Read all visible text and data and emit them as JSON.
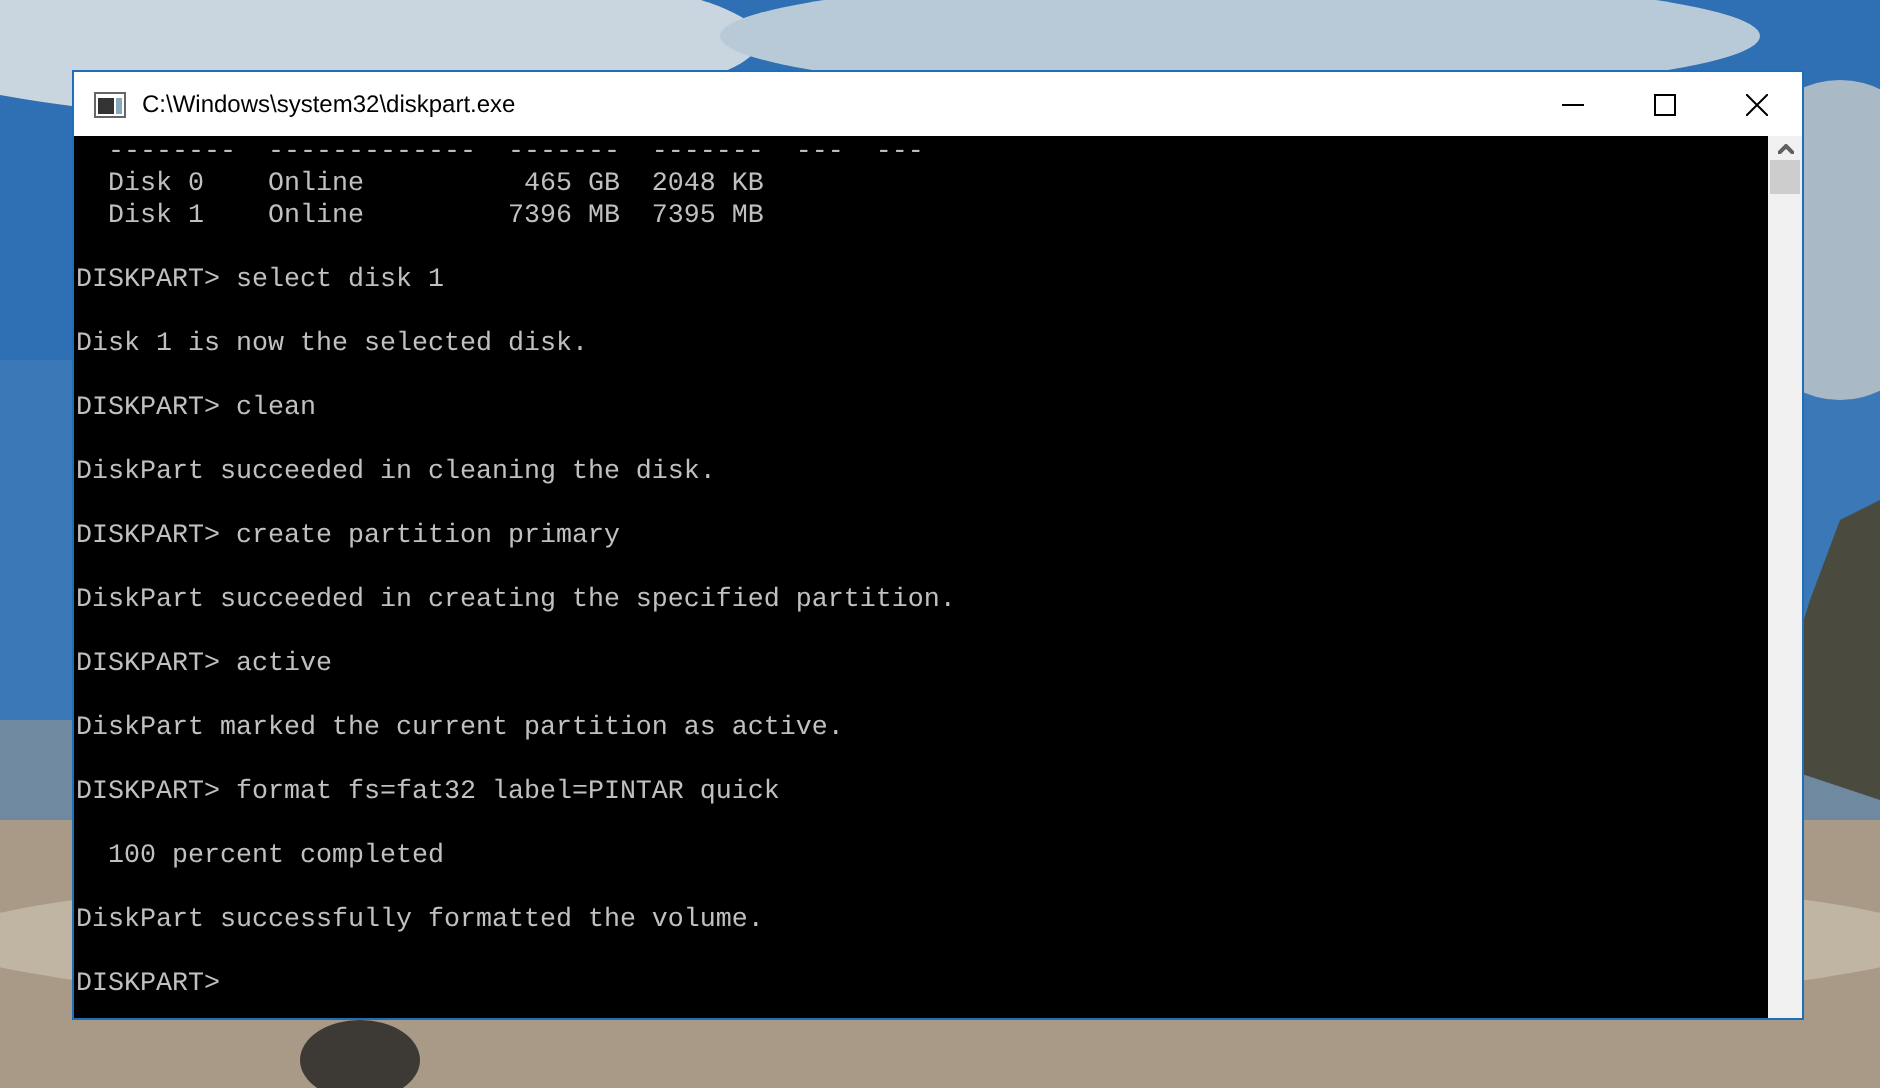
{
  "window": {
    "title": "C:\\Windows\\system32\\diskpart.exe"
  },
  "console": {
    "lines": [
      {
        "kind": "table_row",
        "text": "  --------  -------------  -------  -------  ---  ---"
      },
      {
        "kind": "table_row",
        "text": "  Disk 0    Online          465 GB  2048 KB"
      },
      {
        "kind": "table_row",
        "text": "  Disk 1    Online         7396 MB  7395 MB"
      },
      {
        "kind": "command",
        "text": "DISKPART> select disk 1"
      },
      {
        "kind": "output",
        "text": "Disk 1 is now the selected disk."
      },
      {
        "kind": "command",
        "text": "DISKPART> clean"
      },
      {
        "kind": "output",
        "text": "DiskPart succeeded in cleaning the disk."
      },
      {
        "kind": "command",
        "text": "DISKPART> create partition primary"
      },
      {
        "kind": "output",
        "text": "DiskPart succeeded in creating the specified partition."
      },
      {
        "kind": "command",
        "text": "DISKPART> active"
      },
      {
        "kind": "output",
        "text": "DiskPart marked the current partition as active."
      },
      {
        "kind": "command",
        "text": "DISKPART> format fs=fat32 label=PINTAR quick"
      },
      {
        "kind": "output",
        "text": "  100 percent completed"
      },
      {
        "kind": "output",
        "text": "DiskPart successfully formatted the volume."
      },
      {
        "kind": "command",
        "text": "DISKPART>"
      }
    ]
  }
}
